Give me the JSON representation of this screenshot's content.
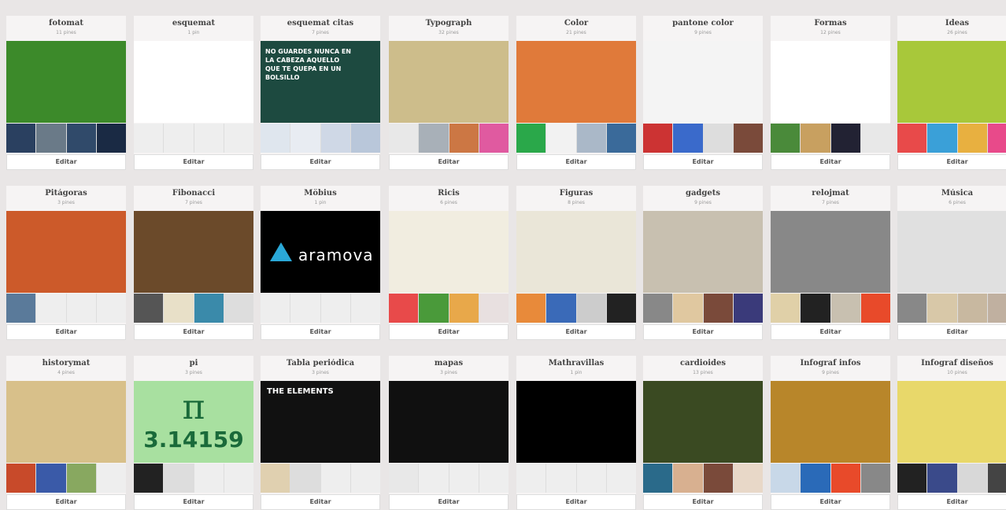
{
  "boards": [
    {
      "title": "fotomat",
      "count": "11 pines",
      "edit": "Editar",
      "cover": "#3c8a2a",
      "thumbs": [
        "#2a4060",
        "#6a7a88",
        "#304a6a",
        "#1a2a44"
      ]
    },
    {
      "title": "esquemat",
      "count": "1 pin",
      "edit": "Editar",
      "cover": "#ffffff",
      "thumbs": [
        "#eeeeee",
        "#eeeeee",
        "#eeeeee",
        "#eeeeee"
      ]
    },
    {
      "title": "esquemat citas",
      "count": "7 pines",
      "edit": "Editar",
      "cover": "#1d4a40",
      "cover_text": "NO GUARDES NUNCA EN LA CABEZA AQUELLO QUE TE QUEPA EN UN BOLSILLO",
      "thumbs": [
        "#dfe6ee",
        "#e8ecf2",
        "#cfd8e6",
        "#b9c7da"
      ]
    },
    {
      "title": "Typograph",
      "count": "32 pines",
      "edit": "Editar",
      "cover": "#cdbd8b",
      "thumbs": [
        "#e8e8e8",
        "#a8b0b8",
        "#cc7744",
        "#e05aa0"
      ]
    },
    {
      "title": "Color",
      "count": "21 pines",
      "edit": "Editar",
      "cover": "#e07a3a",
      "thumbs": [
        "#2aa84a",
        "#f2f2f2",
        "#aab8c8",
        "#3a6a9a"
      ]
    },
    {
      "title": "pantone color",
      "count": "9 pines",
      "edit": "Editar",
      "cover": "#f4f4f4",
      "thumbs": [
        "#c33",
        "#3a6acb",
        "#ddd",
        "#7a4a3a"
      ]
    },
    {
      "title": "Formas",
      "count": "12 pines",
      "edit": "Editar",
      "cover": "#ffffff",
      "thumbs": [
        "#4a8a3a",
        "#c8a060",
        "#222233",
        "#e8e8e8"
      ]
    },
    {
      "title": "Ideas",
      "count": "26 pines",
      "edit": "Editar",
      "cover": "#a8c83a",
      "thumbs": [
        "#e84a4a",
        "#3aa0d8",
        "#e8b040",
        "#e84a8a"
      ]
    },
    {
      "title": "Pitágoras",
      "count": "3 pines",
      "edit": "Editar",
      "cover": "#cc5a2a",
      "thumbs": [
        "#5a7a9a",
        "#eeeeee",
        "#eeeeee",
        "#eeeeee"
      ]
    },
    {
      "title": "Fibonacci",
      "count": "7 pines",
      "edit": "Editar",
      "cover": "#6b4a2a",
      "thumbs": [
        "#555",
        "#e8e0c8",
        "#3a8aaa",
        "#ddd"
      ]
    },
    {
      "title": "Möbius",
      "count": "1 pin",
      "edit": "Editar",
      "cover": "#000000",
      "cover_text": "aramova",
      "thumbs": [
        "#eeeeee",
        "#eeeeee",
        "#eeeeee",
        "#eeeeee"
      ]
    },
    {
      "title": "Ricis",
      "count": "6 pines",
      "edit": "Editar",
      "cover": "#f1ede0",
      "thumbs": [
        "#e84a4a",
        "#4a9a3a",
        "#e8a84a",
        "#e8e0e0"
      ]
    },
    {
      "title": "Figuras",
      "count": "8 pines",
      "edit": "Editar",
      "cover": "#eae6d8",
      "thumbs": [
        "#e88a3a",
        "#3a6ab8",
        "#cccccc",
        "#222222"
      ]
    },
    {
      "title": "gadgets",
      "count": "9 pines",
      "edit": "Editar",
      "cover": "#c8c0b0",
      "thumbs": [
        "#888",
        "#e0c8a0",
        "#7a4a3a",
        "#3a3a7a"
      ]
    },
    {
      "title": "relojmat",
      "count": "7 pines",
      "edit": "Editar",
      "cover": "#888888",
      "thumbs": [
        "#e0d0a8",
        "#222",
        "#c8c0b0",
        "#e84a2a"
      ]
    },
    {
      "title": "Música",
      "count": "6 pines",
      "edit": "Editar",
      "cover": "#e0e0e0",
      "thumbs": [
        "#888",
        "#d8c8a8",
        "#c8b8a0",
        "#c0b0a0"
      ]
    },
    {
      "title": "historymat",
      "count": "4 pines",
      "edit": "Editar",
      "cover": "#d8c08a",
      "thumbs": [
        "#c84a2a",
        "#3a5aa8",
        "#88a860",
        "#eeeeee"
      ]
    },
    {
      "title": "pi",
      "count": "3 pines",
      "edit": "Editar",
      "cover": "#a8e0a0",
      "cover_text": "3.14159",
      "thumbs": [
        "#222",
        "#ddd",
        "#eeeeee",
        "#eeeeee"
      ]
    },
    {
      "title": "Tabla periódica",
      "count": "3 pines",
      "edit": "Editar",
      "cover": "#111111",
      "cover_text": "THE ELEMENTS",
      "thumbs": [
        "#e0d0b0",
        "#ddd",
        "#eeeeee",
        "#eeeeee"
      ]
    },
    {
      "title": "mapas",
      "count": "3 pines",
      "edit": "Editar",
      "cover": "#101010",
      "thumbs": [
        "#e8e8e8",
        "#eeeeee",
        "#eeeeee",
        "#eeeeee"
      ]
    },
    {
      "title": "Mathravillas",
      "count": "1 pin",
      "edit": "Editar",
      "cover": "#000000",
      "thumbs": [
        "#eeeeee",
        "#eeeeee",
        "#eeeeee",
        "#eeeeee"
      ]
    },
    {
      "title": "cardioides",
      "count": "13 pines",
      "edit": "Editar",
      "cover": "#3a4a22",
      "thumbs": [
        "#2a6a8a",
        "#d8b090",
        "#7a4a3a",
        "#e8d8c8"
      ]
    },
    {
      "title": "Infograf infos",
      "count": "9 pines",
      "edit": "Editar",
      "cover": "#b8862a",
      "thumbs": [
        "#c8d8e8",
        "#2a6ab8",
        "#e84a2a",
        "#888"
      ]
    },
    {
      "title": "Infograf diseños",
      "count": "10 pines",
      "edit": "Editar",
      "cover": "#e8d86a",
      "thumbs": [
        "#222",
        "#3a4a8a",
        "#d8d8d8",
        "#444"
      ]
    }
  ]
}
